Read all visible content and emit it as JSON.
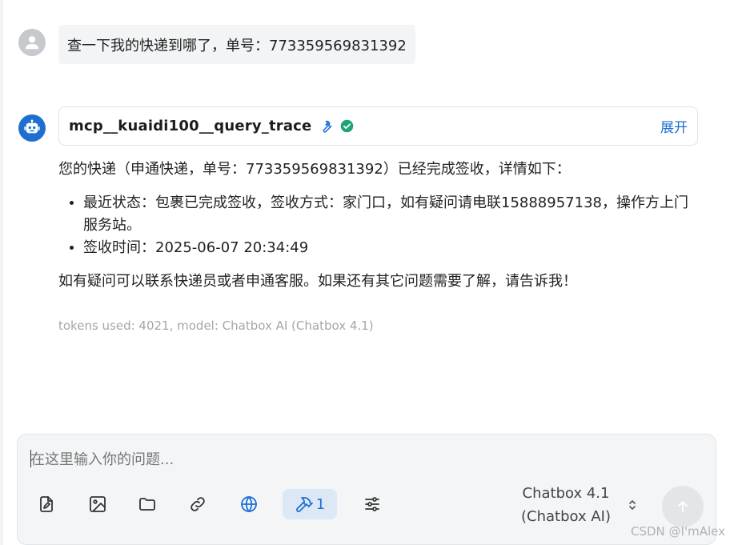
{
  "messages": {
    "user": {
      "text": "查一下我的快递到哪了，单号：773359569831392"
    },
    "assistant": {
      "tool_call": {
        "name": "mcp__kuaidi100__query_trace",
        "expand_label": "展开"
      },
      "intro": "您的快递（申通快递，单号：773359569831392）已经完成签收，详情如下：",
      "bullets": [
        "最近状态：包裹已完成签收，签收方式：家门口，如有疑问请电联15888957138，操作方上门服务站。",
        "签收时间：2025-06-07 20:34:49"
      ],
      "closing": "如有疑问可以联系快递员或者申通客服。如果还有其它问题需要了解，请告诉我！",
      "meta": "tokens used: 4021, model: Chatbox AI (Chatbox 4.1)"
    }
  },
  "composer": {
    "placeholder": "在这里输入你的问题...",
    "tools_count": "1",
    "model_line1": "Chatbox 4.1",
    "model_line2": "(Chatbox AI)"
  },
  "watermark": "CSDN @I'mAlex",
  "colors": {
    "accent": "#1e6fd4",
    "success": "#1fa37a",
    "bot_avatar": "#1f6fd0"
  }
}
